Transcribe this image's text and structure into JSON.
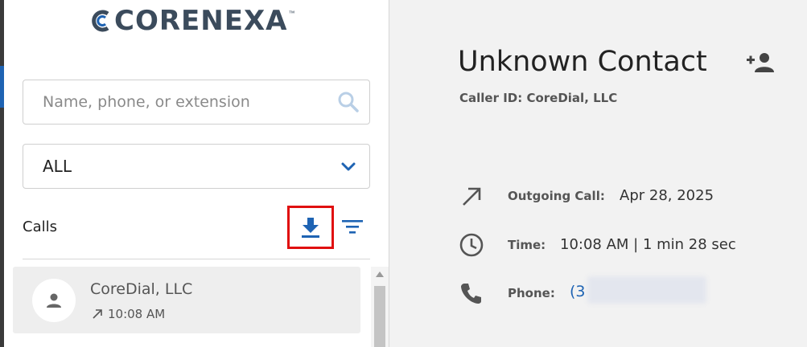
{
  "app": {
    "brand_name": "CORENEXA",
    "trademark": "™"
  },
  "search": {
    "placeholder": "Name, phone, or extension",
    "value": ""
  },
  "filter_select": {
    "selected": "ALL"
  },
  "calls_section": {
    "title": "Calls"
  },
  "call_list": [
    {
      "name": "CoreDial, LLC",
      "direction": "outgoing",
      "time": "10:08 AM"
    }
  ],
  "contact": {
    "name": "Unknown Contact",
    "caller_id": "Caller ID: CoreDial, LLC",
    "details": {
      "call_type_label": "Outgoing Call:",
      "call_date": "Apr 28, 2025",
      "time_label": "Time:",
      "time_value": "10:08 AM | 1 min 28 sec",
      "phone_label": "Phone:",
      "phone_value": "(3"
    }
  },
  "colors": {
    "accent": "#1e63b3",
    "highlight_border": "#e01010",
    "sidebar_bg": "#ffffff",
    "main_bg": "#f2f2f2"
  },
  "icons": [
    "search-icon",
    "chevron-down-icon",
    "download-icon",
    "filter-icon",
    "person-icon",
    "outgoing-arrow-icon",
    "add-person-icon",
    "clock-icon",
    "phone-icon"
  ]
}
